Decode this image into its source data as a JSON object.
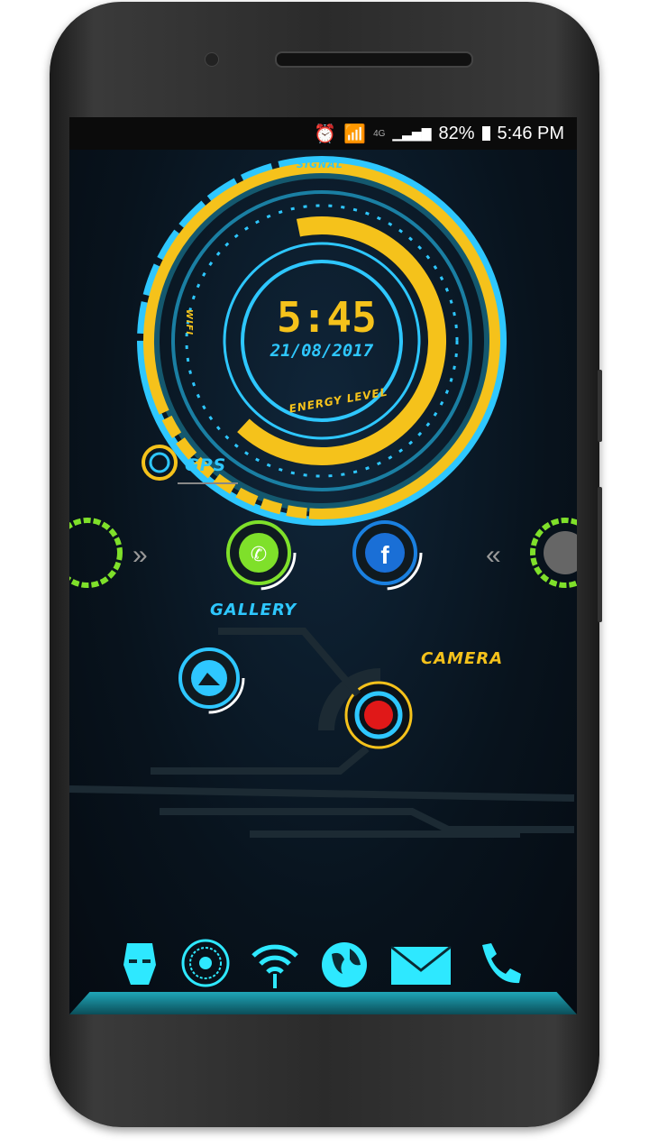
{
  "status_bar": {
    "network": "4G",
    "battery": "82%",
    "time": "5:46 PM",
    "icons": [
      "alarm-icon",
      "wifi-icon",
      "signal-icon",
      "battery-charging-icon"
    ]
  },
  "clock_widget": {
    "time": "5:45",
    "date": "21/08/2017",
    "signal_label": "SIGNAL",
    "wifi_label": "WIFI",
    "energy_label": "ENERGY LEVEL",
    "gps_label": "GPS"
  },
  "apps": {
    "gallery_label": "GALLERY",
    "camera_label": "CAMERA"
  },
  "dock": {
    "icons": [
      "iron-man-icon",
      "arc-reactor-icon",
      "wifi-icon",
      "globe-icon",
      "mail-icon",
      "phone-icon"
    ]
  },
  "colors": {
    "cyan": "#2ec7ff",
    "yellow": "#f5c21b",
    "green": "#7fe02a",
    "red": "#e01818"
  }
}
